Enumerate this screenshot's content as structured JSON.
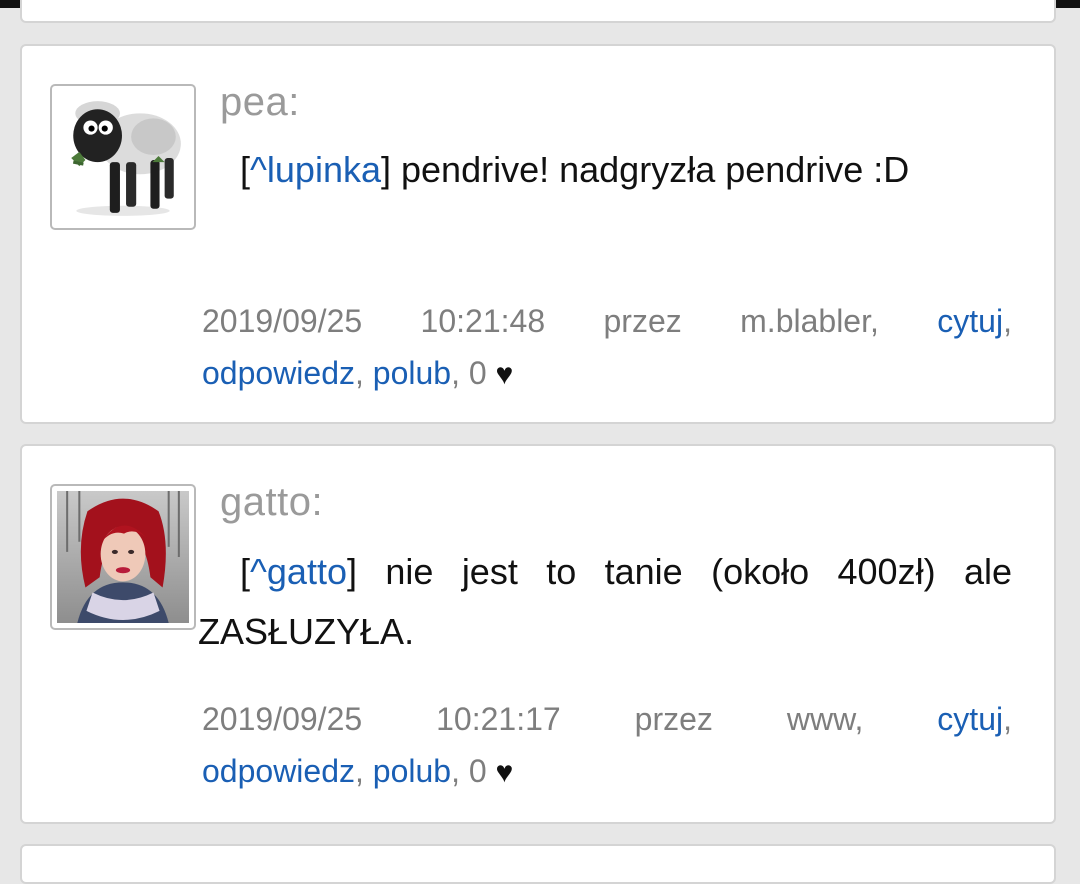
{
  "posts": [
    {
      "author": "pea:",
      "mention": "^lupinka",
      "message_rest": " pendrive! nadgryzła pendrive :D",
      "date": "2019/09/25",
      "time": "10:21:48",
      "via_label": "przez",
      "via": "m.blabler,",
      "quote": "cytuj",
      "reply": "odpowiedz",
      "like": "polub",
      "likes": "0",
      "avatar_icon": "sheep-avatar-icon"
    },
    {
      "author": "gatto:",
      "mention": "^gatto",
      "message_rest": " nie jest to tanie (około 400zł) ale ZASŁUZYŁA.",
      "date": "2019/09/25",
      "time": "10:21:17",
      "via_label": "przez",
      "via": "www,",
      "quote": "cytuj",
      "reply": "odpowiedz",
      "like": "polub",
      "likes": "0",
      "avatar_icon": "user-photo-avatar"
    }
  ],
  "colors": {
    "link": "#1a5fb4",
    "author": "#9a9a9a",
    "meta": "#7e7e7e",
    "background": "#e7e7e7"
  }
}
